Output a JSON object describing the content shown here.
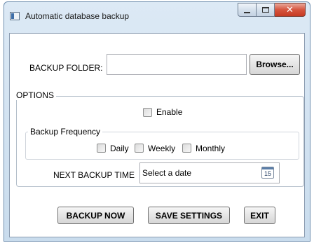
{
  "window": {
    "title": "Automatic database backup",
    "close_glyph": "✕"
  },
  "backup_folder": {
    "label": "BACKUP FOLDER:",
    "value": "",
    "browse_label": "Browse..."
  },
  "options": {
    "legend": "OPTIONS",
    "enable_label": "Enable",
    "enable_checked": false,
    "frequency": {
      "legend": "Backup Frequency",
      "daily_label": "Daily",
      "weekly_label": "Weekly",
      "monthly_label": "Monthly"
    },
    "next_backup": {
      "label": "NEXT BACKUP TIME",
      "placeholder": "Select a date",
      "calendar_day": "15"
    }
  },
  "actions": {
    "backup_now_label": "BACKUP NOW",
    "save_settings_label": "SAVE SETTINGS",
    "exit_label": "EXIT"
  },
  "icons": {
    "app": "app-icon",
    "minimize": "minimize-icon",
    "maximize": "maximize-icon",
    "close": "close-icon",
    "calendar": "calendar-icon"
  },
  "colors": {
    "close_button": "#c53a22",
    "frame": "#c9dced"
  }
}
